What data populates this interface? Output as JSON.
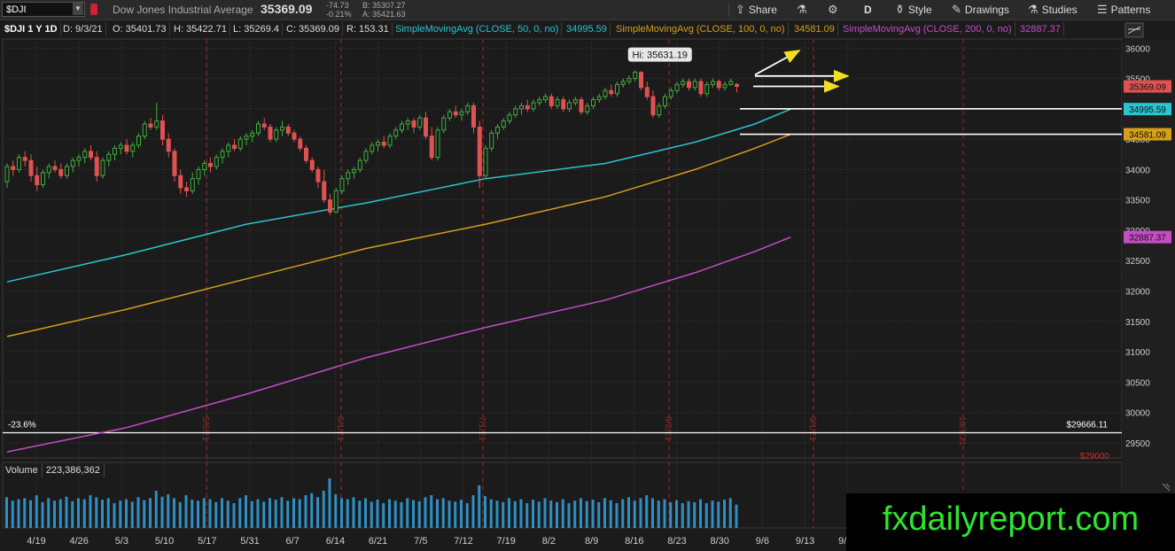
{
  "toolbar": {
    "symbol": "$DJI",
    "description": "Dow Jones Industrial Average",
    "last": "35369.09",
    "change": "-74.73",
    "change_pct": "-0.21%",
    "bid": "B: 35307.27",
    "ask": "A: 35421.63",
    "share": "Share",
    "period": "D",
    "style": "Style",
    "drawings": "Drawings",
    "studies": "Studies",
    "patterns": "Patterns"
  },
  "infobar": {
    "title": "$DJI 1 Y 1D",
    "date": "D: 9/3/21",
    "open": "O: 35401.73",
    "high": "H: 35422.71",
    "low": "L: 35269.4",
    "close": "C: 35369.09",
    "range": "R: 153.31",
    "sma50_label": "SimpleMovingAvg (CLOSE, 50, 0, no)",
    "sma50_value": "34995.59",
    "sma100_label": "SimpleMovingAvg (CLOSE, 100, 0, no)",
    "sma100_value": "34581.09",
    "sma200_label": "SimpleMovingAvg (CLOSE, 200, 0, no)",
    "sma200_value": "32887.37"
  },
  "volume": {
    "label": "Volume",
    "value": "223,386,362"
  },
  "watermark": "fxdailyreport.com",
  "colors": {
    "up": "#3fae3f",
    "down": "#e05252",
    "sma50": "#29c4cf",
    "sma100": "#d4a01a",
    "sma200": "#c64cc6",
    "volume": "#2f8fc4",
    "grid": "#3a3a3a",
    "marker": "#a3262a"
  },
  "chart_data": {
    "type": "candlestick",
    "symbol": "$DJI",
    "y_ticks": [
      29500,
      30000,
      30500,
      31000,
      31500,
      32000,
      32500,
      33000,
      33500,
      34000,
      34500,
      35000,
      35500,
      36000
    ],
    "ylim": [
      29250,
      36150
    ],
    "x_dates": [
      "4/19",
      "4/26",
      "5/3",
      "5/10",
      "5/17",
      "5/31",
      "6/7",
      "6/14",
      "6/21",
      "7/5",
      "7/12",
      "7/19",
      "8/2",
      "8/9",
      "8/16",
      "8/23",
      "8/30",
      "9/6",
      "9/13",
      "9/20"
    ],
    "month_markers": [
      "5/3/21",
      "6/1/21",
      "7/1/21",
      "8/2/21",
      "9/1/21",
      "10/1/21"
    ],
    "price_labels": [
      {
        "text": "35369.09",
        "value": 35369.09,
        "color": "#e05252"
      },
      {
        "text": "34995.59",
        "value": 34995.59,
        "color": "#29c4cf"
      },
      {
        "text": "34581.09",
        "value": 34581.09,
        "color": "#d4a01a"
      },
      {
        "text": "32887.37",
        "value": 32887.37,
        "color": "#c64cc6"
      }
    ],
    "hi_callout": {
      "text": "Hi: 35631.19",
      "value": 35631.19
    },
    "fib_level": {
      "label": "-23.6%",
      "value": 29666.11,
      "text": "$29666.11"
    },
    "partial_label": "$29000",
    "horizontal_lines": [
      35000,
      34581
    ],
    "sma50": [
      [
        0,
        32150
      ],
      [
        20,
        32600
      ],
      [
        40,
        33100
      ],
      [
        60,
        33450
      ],
      [
        80,
        33850
      ],
      [
        100,
        34100
      ],
      [
        115,
        34450
      ],
      [
        125,
        34750
      ],
      [
        131,
        34995
      ]
    ],
    "sma100": [
      [
        0,
        31250
      ],
      [
        20,
        31700
      ],
      [
        40,
        32200
      ],
      [
        60,
        32700
      ],
      [
        80,
        33100
      ],
      [
        100,
        33550
      ],
      [
        115,
        34000
      ],
      [
        125,
        34350
      ],
      [
        131,
        34581
      ]
    ],
    "sma200": [
      [
        0,
        29350
      ],
      [
        20,
        29750
      ],
      [
        40,
        30300
      ],
      [
        60,
        30900
      ],
      [
        80,
        31400
      ],
      [
        100,
        31850
      ],
      [
        115,
        32300
      ],
      [
        125,
        32650
      ],
      [
        131,
        32887
      ]
    ],
    "candles": [
      [
        0,
        33800,
        34100,
        33700,
        34050
      ],
      [
        1,
        34050,
        34150,
        33900,
        34000
      ],
      [
        2,
        34000,
        34250,
        33950,
        34200
      ],
      [
        3,
        34200,
        34300,
        34050,
        34150
      ],
      [
        4,
        34150,
        34250,
        33800,
        33900
      ],
      [
        5,
        33900,
        34050,
        33650,
        33750
      ],
      [
        6,
        33750,
        34000,
        33700,
        33950
      ],
      [
        7,
        33950,
        34100,
        33850,
        34050
      ],
      [
        8,
        34050,
        34150,
        33950,
        34000
      ],
      [
        9,
        34000,
        34100,
        33850,
        33900
      ],
      [
        10,
        33900,
        34100,
        33850,
        34050
      ],
      [
        11,
        34050,
        34200,
        33950,
        34150
      ],
      [
        12,
        34150,
        34250,
        34050,
        34200
      ],
      [
        13,
        34200,
        34350,
        34100,
        34300
      ],
      [
        14,
        34300,
        34400,
        34150,
        34200
      ],
      [
        15,
        34200,
        34300,
        33800,
        33900
      ],
      [
        16,
        33900,
        34200,
        33850,
        34150
      ],
      [
        17,
        34150,
        34300,
        34050,
        34250
      ],
      [
        18,
        34250,
        34400,
        34150,
        34350
      ],
      [
        19,
        34350,
        34450,
        34250,
        34400
      ],
      [
        20,
        34400,
        34500,
        34250,
        34300
      ],
      [
        21,
        34300,
        34450,
        34200,
        34400
      ],
      [
        22,
        34400,
        34600,
        34350,
        34550
      ],
      [
        23,
        34550,
        34800,
        34500,
        34750
      ],
      [
        24,
        34750,
        34850,
        34650,
        34700
      ],
      [
        25,
        34700,
        35100,
        34650,
        34800
      ],
      [
        26,
        34800,
        34900,
        34400,
        34500
      ],
      [
        27,
        34500,
        34600,
        34200,
        34300
      ],
      [
        28,
        34300,
        34350,
        33800,
        33900
      ],
      [
        29,
        33900,
        34000,
        33600,
        33700
      ],
      [
        30,
        33700,
        33800,
        33550,
        33650
      ],
      [
        31,
        33650,
        33950,
        33600,
        33850
      ],
      [
        32,
        33850,
        34050,
        33750,
        34000
      ],
      [
        33,
        34000,
        34150,
        33900,
        34100
      ],
      [
        34,
        34100,
        34200,
        33950,
        34050
      ],
      [
        35,
        34050,
        34250,
        34000,
        34200
      ],
      [
        36,
        34200,
        34350,
        34100,
        34300
      ],
      [
        37,
        34300,
        34450,
        34200,
        34400
      ],
      [
        38,
        34400,
        34500,
        34300,
        34350
      ],
      [
        39,
        34350,
        34550,
        34300,
        34500
      ],
      [
        40,
        34500,
        34600,
        34400,
        34550
      ],
      [
        41,
        34550,
        34650,
        34450,
        34600
      ],
      [
        42,
        34600,
        34800,
        34550,
        34750
      ],
      [
        43,
        34750,
        34850,
        34650,
        34700
      ],
      [
        44,
        34700,
        34750,
        34450,
        34500
      ],
      [
        45,
        34500,
        34700,
        34450,
        34650
      ],
      [
        46,
        34650,
        34800,
        34550,
        34700
      ],
      [
        47,
        34700,
        34750,
        34550,
        34600
      ],
      [
        48,
        34600,
        34650,
        34450,
        34500
      ],
      [
        49,
        34500,
        34550,
        34300,
        34350
      ],
      [
        50,
        34350,
        34400,
        34100,
        34150
      ],
      [
        51,
        34150,
        34200,
        33950,
        34000
      ],
      [
        52,
        34000,
        34050,
        33700,
        33800
      ],
      [
        53,
        33800,
        34000,
        33450,
        33500
      ],
      [
        54,
        33500,
        33600,
        33250,
        33300
      ],
      [
        55,
        33300,
        33700,
        33280,
        33650
      ],
      [
        56,
        33650,
        33900,
        33600,
        33850
      ],
      [
        57,
        33850,
        34000,
        33750,
        33950
      ],
      [
        58,
        33950,
        34050,
        33850,
        34000
      ],
      [
        59,
        34000,
        34200,
        33950,
        34150
      ],
      [
        60,
        34150,
        34350,
        34100,
        34300
      ],
      [
        61,
        34300,
        34450,
        34250,
        34400
      ],
      [
        62,
        34400,
        34500,
        34300,
        34450
      ],
      [
        63,
        34450,
        34550,
        34350,
        34400
      ],
      [
        64,
        34400,
        34600,
        34350,
        34550
      ],
      [
        65,
        34550,
        34700,
        34500,
        34650
      ],
      [
        66,
        34650,
        34800,
        34600,
        34750
      ],
      [
        67,
        34750,
        34850,
        34650,
        34800
      ],
      [
        68,
        34800,
        34850,
        34600,
        34700
      ],
      [
        69,
        34700,
        34900,
        34650,
        34850
      ],
      [
        70,
        34850,
        34950,
        34500,
        34550
      ],
      [
        71,
        34550,
        34700,
        34150,
        34200
      ],
      [
        72,
        34200,
        34700,
        34150,
        34650
      ],
      [
        73,
        34650,
        34900,
        34600,
        34850
      ],
      [
        74,
        34850,
        35000,
        34800,
        34950
      ],
      [
        75,
        34950,
        35050,
        34850,
        34900
      ],
      [
        76,
        34900,
        35000,
        34800,
        34950
      ],
      [
        77,
        34950,
        35100,
        34900,
        35050
      ],
      [
        78,
        35050,
        35100,
        34600,
        34700
      ],
      [
        79,
        34700,
        34800,
        33700,
        33900
      ],
      [
        80,
        33900,
        34400,
        33850,
        34350
      ],
      [
        81,
        34350,
        34650,
        34300,
        34600
      ],
      [
        82,
        34600,
        34750,
        34500,
        34700
      ],
      [
        83,
        34700,
        34850,
        34650,
        34800
      ],
      [
        84,
        34800,
        34950,
        34750,
        34900
      ],
      [
        85,
        34900,
        35050,
        34850,
        35000
      ],
      [
        86,
        35000,
        35100,
        34900,
        35050
      ],
      [
        87,
        35050,
        35150,
        34950,
        35000
      ],
      [
        88,
        35000,
        35150,
        34950,
        35100
      ],
      [
        89,
        35100,
        35200,
        35050,
        35150
      ],
      [
        90,
        35150,
        35250,
        35100,
        35200
      ],
      [
        91,
        35200,
        35250,
        35000,
        35050
      ],
      [
        92,
        35050,
        35200,
        35000,
        35150
      ],
      [
        93,
        35150,
        35200,
        34950,
        35000
      ],
      [
        94,
        35000,
        35150,
        34950,
        35100
      ],
      [
        95,
        35100,
        35200,
        35050,
        35150
      ],
      [
        96,
        35150,
        35200,
        34900,
        34950
      ],
      [
        97,
        34950,
        35100,
        34900,
        35050
      ],
      [
        98,
        35050,
        35200,
        35000,
        35150
      ],
      [
        99,
        35150,
        35250,
        35100,
        35200
      ],
      [
        100,
        35200,
        35350,
        35150,
        35300
      ],
      [
        101,
        35300,
        35400,
        35200,
        35250
      ],
      [
        102,
        35250,
        35450,
        35200,
        35400
      ],
      [
        103,
        35400,
        35500,
        35350,
        35450
      ],
      [
        104,
        35450,
        35550,
        35400,
        35500
      ],
      [
        105,
        35500,
        35631,
        35450,
        35600
      ],
      [
        106,
        35600,
        35620,
        35300,
        35350
      ],
      [
        107,
        35350,
        35450,
        35150,
        35200
      ],
      [
        108,
        35200,
        35300,
        34850,
        34900
      ],
      [
        109,
        34900,
        35100,
        34850,
        35050
      ],
      [
        110,
        35050,
        35250,
        35000,
        35200
      ],
      [
        111,
        35200,
        35350,
        35150,
        35300
      ],
      [
        112,
        35300,
        35450,
        35250,
        35400
      ],
      [
        113,
        35400,
        35500,
        35350,
        35450
      ],
      [
        114,
        35450,
        35500,
        35300,
        35350
      ],
      [
        115,
        35350,
        35500,
        35300,
        35450
      ],
      [
        116,
        35450,
        35500,
        35200,
        35250
      ],
      [
        117,
        35250,
        35450,
        35200,
        35400
      ],
      [
        118,
        35400,
        35500,
        35350,
        35450
      ],
      [
        119,
        35450,
        35480,
        35300,
        35350
      ],
      [
        120,
        35350,
        35450,
        35300,
        35400
      ],
      [
        121,
        35400,
        35500,
        35380,
        35450
      ],
      [
        122,
        35401.73,
        35422.71,
        35269.4,
        35369.09
      ]
    ],
    "volumes": [
      [
        0,
        0.62
      ],
      [
        1,
        0.55
      ],
      [
        2,
        0.58
      ],
      [
        3,
        0.6
      ],
      [
        4,
        0.56
      ],
      [
        5,
        0.66
      ],
      [
        6,
        0.52
      ],
      [
        7,
        0.6
      ],
      [
        8,
        0.55
      ],
      [
        9,
        0.58
      ],
      [
        10,
        0.63
      ],
      [
        11,
        0.54
      ],
      [
        12,
        0.6
      ],
      [
        13,
        0.58
      ],
      [
        14,
        0.66
      ],
      [
        15,
        0.62
      ],
      [
        16,
        0.57
      ],
      [
        17,
        0.6
      ],
      [
        18,
        0.5
      ],
      [
        19,
        0.55
      ],
      [
        20,
        0.58
      ],
      [
        21,
        0.53
      ],
      [
        22,
        0.62
      ],
      [
        23,
        0.56
      ],
      [
        24,
        0.6
      ],
      [
        25,
        0.75
      ],
      [
        26,
        0.63
      ],
      [
        27,
        0.68
      ],
      [
        28,
        0.6
      ],
      [
        29,
        0.52
      ],
      [
        30,
        0.66
      ],
      [
        31,
        0.57
      ],
      [
        32,
        0.55
      ],
      [
        33,
        0.6
      ],
      [
        34,
        0.58
      ],
      [
        35,
        0.52
      ],
      [
        36,
        0.6
      ],
      [
        37,
        0.55
      ],
      [
        38,
        0.5
      ],
      [
        39,
        0.6
      ],
      [
        40,
        0.66
      ],
      [
        41,
        0.54
      ],
      [
        42,
        0.58
      ],
      [
        43,
        0.53
      ],
      [
        44,
        0.6
      ],
      [
        45,
        0.57
      ],
      [
        46,
        0.62
      ],
      [
        47,
        0.55
      ],
      [
        48,
        0.6
      ],
      [
        49,
        0.58
      ],
      [
        50,
        0.66
      ],
      [
        51,
        0.7
      ],
      [
        52,
        0.62
      ],
      [
        53,
        0.75
      ],
      [
        54,
        1.0
      ],
      [
        55,
        0.68
      ],
      [
        56,
        0.6
      ],
      [
        57,
        0.58
      ],
      [
        58,
        0.62
      ],
      [
        59,
        0.55
      ],
      [
        60,
        0.6
      ],
      [
        61,
        0.53
      ],
      [
        62,
        0.57
      ],
      [
        63,
        0.5
      ],
      [
        64,
        0.58
      ],
      [
        65,
        0.55
      ],
      [
        66,
        0.52
      ],
      [
        67,
        0.6
      ],
      [
        68,
        0.56
      ],
      [
        69,
        0.54
      ],
      [
        70,
        0.62
      ],
      [
        71,
        0.66
      ],
      [
        72,
        0.58
      ],
      [
        73,
        0.6
      ],
      [
        74,
        0.55
      ],
      [
        75,
        0.53
      ],
      [
        76,
        0.57
      ],
      [
        77,
        0.5
      ],
      [
        78,
        0.66
      ],
      [
        79,
        0.86
      ],
      [
        80,
        0.64
      ],
      [
        81,
        0.58
      ],
      [
        82,
        0.55
      ],
      [
        83,
        0.52
      ],
      [
        84,
        0.6
      ],
      [
        85,
        0.54
      ],
      [
        86,
        0.58
      ],
      [
        87,
        0.5
      ],
      [
        88,
        0.57
      ],
      [
        89,
        0.53
      ],
      [
        90,
        0.6
      ],
      [
        91,
        0.55
      ],
      [
        92,
        0.52
      ],
      [
        93,
        0.58
      ],
      [
        94,
        0.5
      ],
      [
        95,
        0.55
      ],
      [
        96,
        0.6
      ],
      [
        97,
        0.54
      ],
      [
        98,
        0.57
      ],
      [
        99,
        0.52
      ],
      [
        100,
        0.6
      ],
      [
        101,
        0.56
      ],
      [
        102,
        0.5
      ],
      [
        103,
        0.58
      ],
      [
        104,
        0.62
      ],
      [
        105,
        0.55
      ],
      [
        106,
        0.6
      ],
      [
        107,
        0.66
      ],
      [
        108,
        0.6
      ],
      [
        109,
        0.55
      ],
      [
        110,
        0.58
      ],
      [
        111,
        0.52
      ],
      [
        112,
        0.56
      ],
      [
        113,
        0.5
      ],
      [
        114,
        0.54
      ],
      [
        115,
        0.52
      ],
      [
        116,
        0.58
      ],
      [
        117,
        0.5
      ],
      [
        118,
        0.55
      ],
      [
        119,
        0.53
      ],
      [
        120,
        0.57
      ],
      [
        121,
        0.6
      ],
      [
        122,
        0.47
      ]
    ]
  }
}
